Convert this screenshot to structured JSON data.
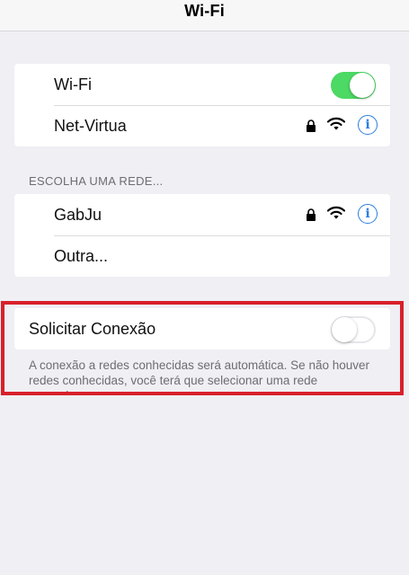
{
  "nav": {
    "title": "Wi-Fi"
  },
  "wifi_group": {
    "wifi_label": "Wi-Fi",
    "wifi_enabled": true,
    "current_network": "Net-Virtua"
  },
  "networks_section": {
    "header": "ESCOLHA UMA REDE...",
    "items": [
      {
        "label": "GabJu",
        "secured": true
      },
      {
        "label": "Outra..."
      }
    ]
  },
  "ask_to_join": {
    "label": "Solicitar Conexão",
    "enabled": false,
    "footer": "A conexão a redes conhecidas será automática. Se não houver redes conhecidas, você terá que selecionar uma rede manualmente."
  },
  "colors": {
    "toggle_on": "#4cd964",
    "accent_blue": "#2b7de0",
    "highlight_red": "#d8202a",
    "background": "#efeff4"
  },
  "icons": [
    "lock-icon",
    "wifi-icon",
    "info-icon"
  ]
}
